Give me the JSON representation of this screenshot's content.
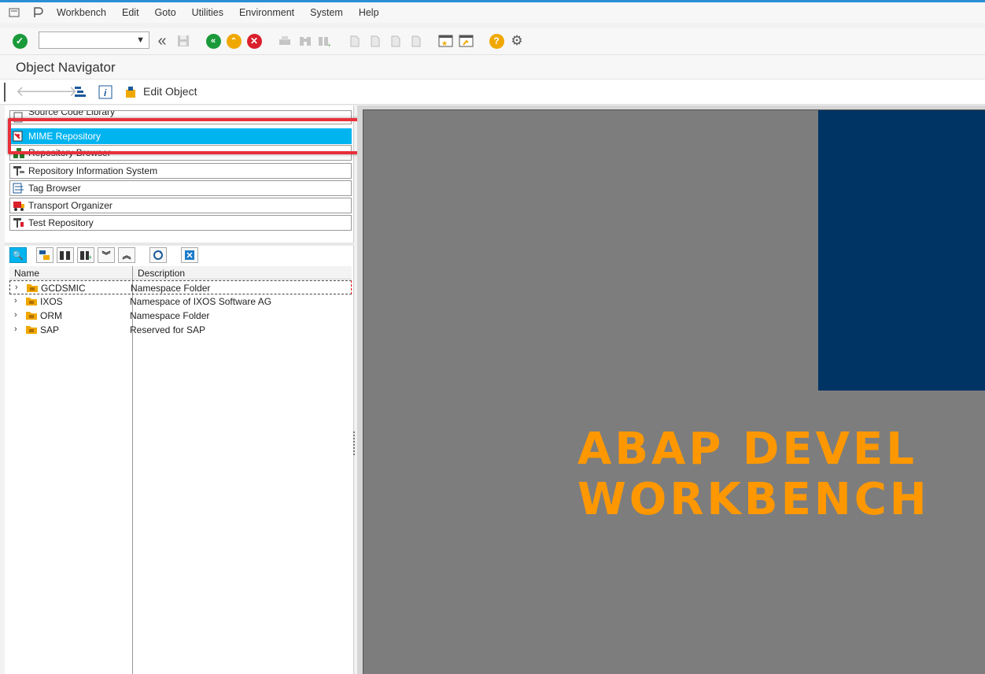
{
  "menu": [
    "Workbench",
    "Edit",
    "Goto",
    "Utilities",
    "Environment",
    "System",
    "Help"
  ],
  "title": "Object Navigator",
  "app_toolbar": {
    "edit_object": "Edit Object"
  },
  "nav_buttons": [
    {
      "label": "Repository Browser",
      "icon": "browser-icon"
    },
    {
      "label": "Repository Information System",
      "icon": "info-system-icon"
    },
    {
      "label": "Tag Browser",
      "icon": "tag-browser-icon"
    },
    {
      "label": "Transport Organizer",
      "icon": "transport-icon"
    },
    {
      "label": "Test Repository",
      "icon": "test-repository-icon"
    }
  ],
  "nav_selected": {
    "label": "MIME Repository",
    "icon": "mime-icon"
  },
  "nav_hidden": "Source Code Library",
  "tree": {
    "columns": [
      "Name",
      "Description"
    ],
    "rows": [
      {
        "name": "GCDSMIC",
        "description": "Namespace Folder"
      },
      {
        "name": "IXOS",
        "description": "Namespace of IXOS Software AG"
      },
      {
        "name": "ORM",
        "description": "Namespace Folder"
      },
      {
        "name": "SAP",
        "description": "Reserved for SAP"
      }
    ]
  },
  "splash": {
    "line1": "ABAP DEVEL",
    "line2": "WORKBENCH"
  },
  "colors": {
    "accent": "#00b4f0",
    "highlight": "#e8303a",
    "logo": "#ff9800",
    "panel": "#003464"
  }
}
